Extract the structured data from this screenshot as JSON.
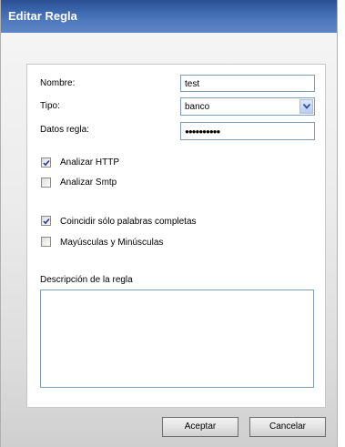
{
  "window": {
    "title": "Editar Regla"
  },
  "form": {
    "nombre_label": "Nombre:",
    "nombre_value": "test",
    "tipo_label": "Tipo:",
    "tipo_value": "banco",
    "datos_label": "Datos regla:",
    "datos_value": "●●●●●●●●●●",
    "checkboxes": [
      {
        "label": "Analizar HTTP",
        "checked": true
      },
      {
        "label": "Analizar Smtp",
        "checked": false
      },
      {
        "label": "Coincidir sólo palabras completas",
        "checked": true
      },
      {
        "label": "Mayúsculas y Minúsculas",
        "checked": false
      }
    ],
    "descripcion_label": "Descripción de la regla",
    "descripcion_value": ""
  },
  "buttons": {
    "accept": "Aceptar",
    "cancel": "Cancelar"
  },
  "colors": {
    "title_bar": "#3a64ab",
    "field_border": "#7f9db9",
    "check_mark": "#1f3a9a"
  }
}
